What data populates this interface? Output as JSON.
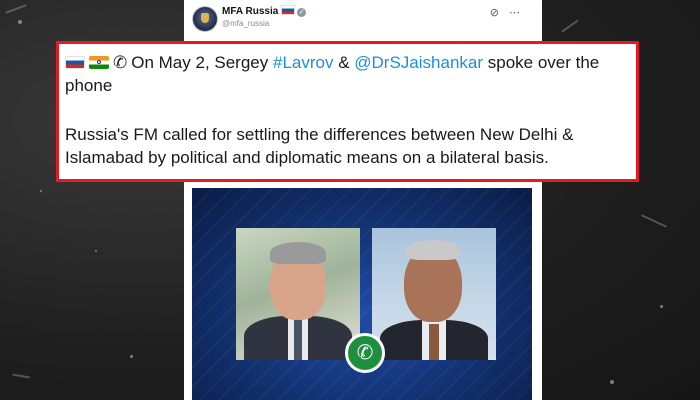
{
  "account": {
    "name": "MFA Russia",
    "handle": "@mfa_russia"
  },
  "tweet": {
    "line1_pre": "On May 2, Sergey ",
    "hashtag": "#Lavrov",
    "line1_mid": " & ",
    "mention": "@DrSJaishankar",
    "line1_post": " spoke over the phone",
    "line2": "Russia's FM called for settling the differences between New Delhi & Islamabad by political and diplomatic means on a bilateral basis."
  },
  "icons": {
    "flag_ru": "russia-flag-icon",
    "flag_in": "india-flag-icon",
    "phone": "telephone-icon",
    "verified": "verified-badge-icon",
    "grok": "grok-icon",
    "more": "more-icon",
    "call": "phone-call-icon"
  },
  "colors": {
    "highlight_border": "#e51b24",
    "link": "#1d8fd8",
    "media_bg": "#12306e",
    "call_green": "#1e8f3e"
  }
}
